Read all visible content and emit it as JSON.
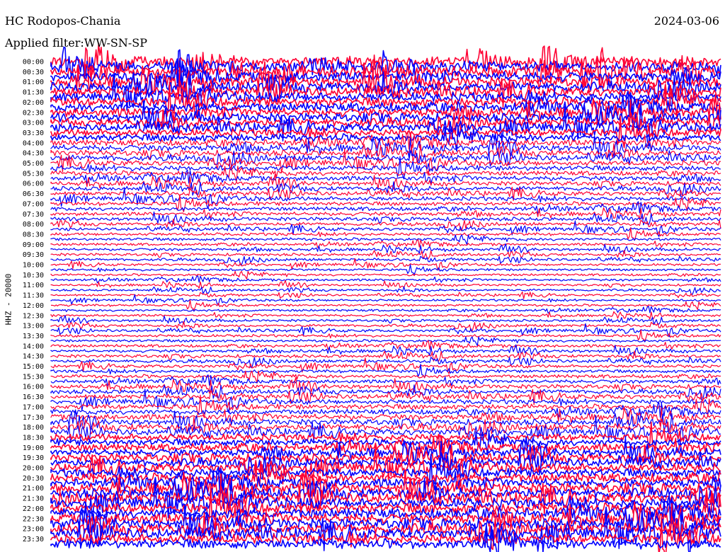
{
  "header": {
    "station": "HC Rodopos-Chania",
    "date": "2024-03-06",
    "filter": "Applied filter:WW-SN-SP"
  },
  "channel_label": "HHZ - 20000",
  "colors": {
    "trace_a": "#0000ff",
    "trace_b": "#ff0033",
    "background": "#ffffff",
    "text": "#000000"
  },
  "chart_data": {
    "type": "line",
    "subtype": "helicorder",
    "title": "HC Rodopos-Chania",
    "date": "2024-03-06",
    "ylabel": "HHZ - 20000",
    "filter": "WW-SN-SP",
    "row_labels": [
      "00:00",
      "00:30",
      "01:00",
      "01:30",
      "02:00",
      "02:30",
      "03:00",
      "03:30",
      "04:00",
      "04:30",
      "05:00",
      "05:30",
      "06:00",
      "06:30",
      "07:00",
      "07:30",
      "08:00",
      "08:30",
      "09:00",
      "09:30",
      "10:00",
      "10:30",
      "11:00",
      "11:30",
      "12:00",
      "12:30",
      "13:00",
      "13:30",
      "14:00",
      "14:30",
      "15:00",
      "15:30",
      "16:00",
      "16:30",
      "17:00",
      "17:30",
      "18:00",
      "18:30",
      "19:00",
      "19:30",
      "20:00",
      "20:30",
      "21:00",
      "21:30",
      "22:00",
      "22:30",
      "23:00",
      "23:30"
    ],
    "minutes_per_row": 15,
    "trace_colors": [
      "#ff0033",
      "#0000ff"
    ],
    "relative_amplitude": [
      1.0,
      0.95,
      0.9,
      0.85,
      0.85,
      0.8,
      0.75,
      0.7,
      0.6,
      0.55,
      0.5,
      0.45,
      0.4,
      0.4,
      0.38,
      0.35,
      0.3,
      0.28,
      0.25,
      0.25,
      0.22,
      0.22,
      0.2,
      0.2,
      0.22,
      0.22,
      0.25,
      0.25,
      0.28,
      0.3,
      0.3,
      0.35,
      0.4,
      0.45,
      0.5,
      0.55,
      0.6,
      0.65,
      0.7,
      0.75,
      0.8,
      0.85,
      0.9,
      0.92,
      0.95,
      0.95,
      0.95,
      0.9
    ],
    "grid": false
  }
}
